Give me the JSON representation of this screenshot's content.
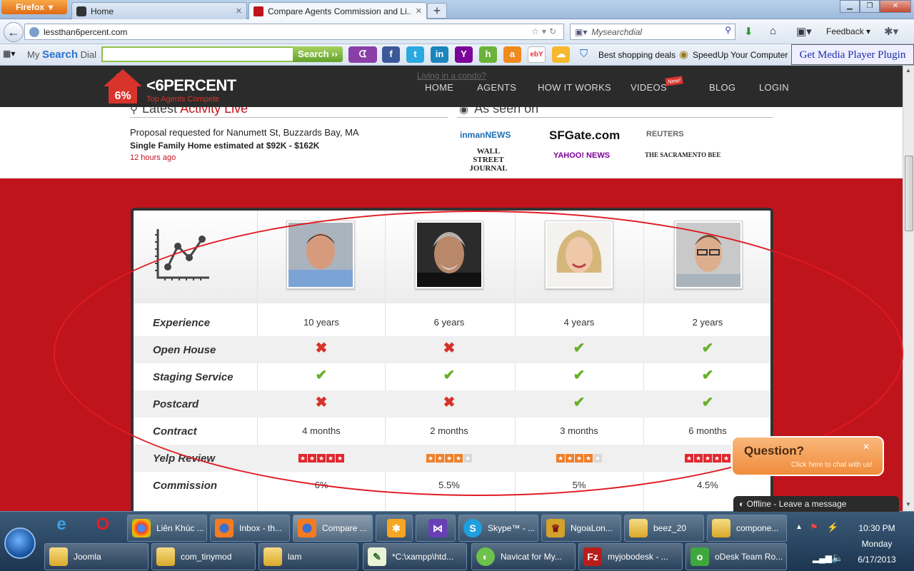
{
  "browser": {
    "app_button": "Firefox",
    "tabs": [
      {
        "label": "Home"
      },
      {
        "label": "Compare Agents Commission and Li..."
      }
    ],
    "url": "lessthan6percent.com",
    "search_placeholder": "Mysearchdial",
    "feedback_label": "Feedback"
  },
  "toolbar": {
    "brand_prefix": "My ",
    "brand_search": "Search",
    "brand_suffix": " Dial",
    "search_button": "Search",
    "shopping_label": "Best shopping deals",
    "speedup_label": "SpeedUp Your Computer",
    "media_plugin": "Get Media Player Plugin"
  },
  "site": {
    "logo_percent": "6%",
    "logo_brand": "<6PERCENT",
    "logo_tagline": "Top Agents Compete",
    "condo_link": "Living in a condo?",
    "nav": [
      "HOME",
      "AGENTS",
      "HOW IT WORKS",
      "VIDEOS",
      "BLOG",
      "LOGIN"
    ],
    "new_badge": "New!",
    "activity_title": "Latest",
    "activity_title_red": "Activity Live",
    "activity_line1": "Proposal requested for Nanumett St, Buzzards Bay, MA",
    "activity_line2": "Single Family Home estimated at $92K - $162K",
    "activity_time": "12 hours ago",
    "seen_title": "As seen on",
    "press": [
      "inmanNEWS",
      "SFGate.com",
      "REUTERS",
      "WALL STREET JOURNAL",
      "YAHOO! NEWS",
      "THE SACRAMENTO BEE"
    ]
  },
  "comparison": {
    "row_labels": [
      "Experience",
      "Open House",
      "Staging Service",
      "Postcard",
      "Contract",
      "Yelp Review",
      "Commission"
    ],
    "agents": [
      {
        "experience": "10 years",
        "open_house": false,
        "staging": true,
        "postcard": false,
        "contract": "4 months",
        "yelp_stars": 5,
        "commission": "6%"
      },
      {
        "experience": "6 years",
        "open_house": false,
        "staging": true,
        "postcard": false,
        "contract": "2 months",
        "yelp_stars": 4,
        "commission": "5.5%"
      },
      {
        "experience": "4 years",
        "open_house": true,
        "staging": true,
        "postcard": true,
        "contract": "3 months",
        "yelp_stars": 4,
        "commission": "5%"
      },
      {
        "experience": "2 years",
        "open_house": true,
        "staging": true,
        "postcard": true,
        "contract": "6 months",
        "yelp_stars": 5,
        "commission": "4.5%"
      }
    ]
  },
  "chat": {
    "question": "Question?",
    "subtitle": "Click here to chat with us!",
    "offline_bold": "Offline",
    "offline_rest": " - Leave a message"
  },
  "taskbar": {
    "row1": [
      "Liên Khúc ...",
      "Inbox - th...",
      "Compare ...",
      "",
      "",
      "Skype™ - ...",
      "NgoaLon...",
      "beez_20",
      "compone..."
    ],
    "row2": [
      "Joomla",
      "com_tinymod",
      "lam",
      "*C:\\xampp\\htd...",
      "Navicat for My...",
      "myjobodesk - ...",
      "oDesk Team Ro..."
    ],
    "time": "10:30 PM",
    "day": "Monday",
    "date": "6/17/2013"
  },
  "colors": {
    "brand_red": "#c0141d",
    "check_green": "#69b02c",
    "cross_red": "#d63329",
    "star_red": "#e0282e",
    "star_orange": "#ef7f2a"
  }
}
